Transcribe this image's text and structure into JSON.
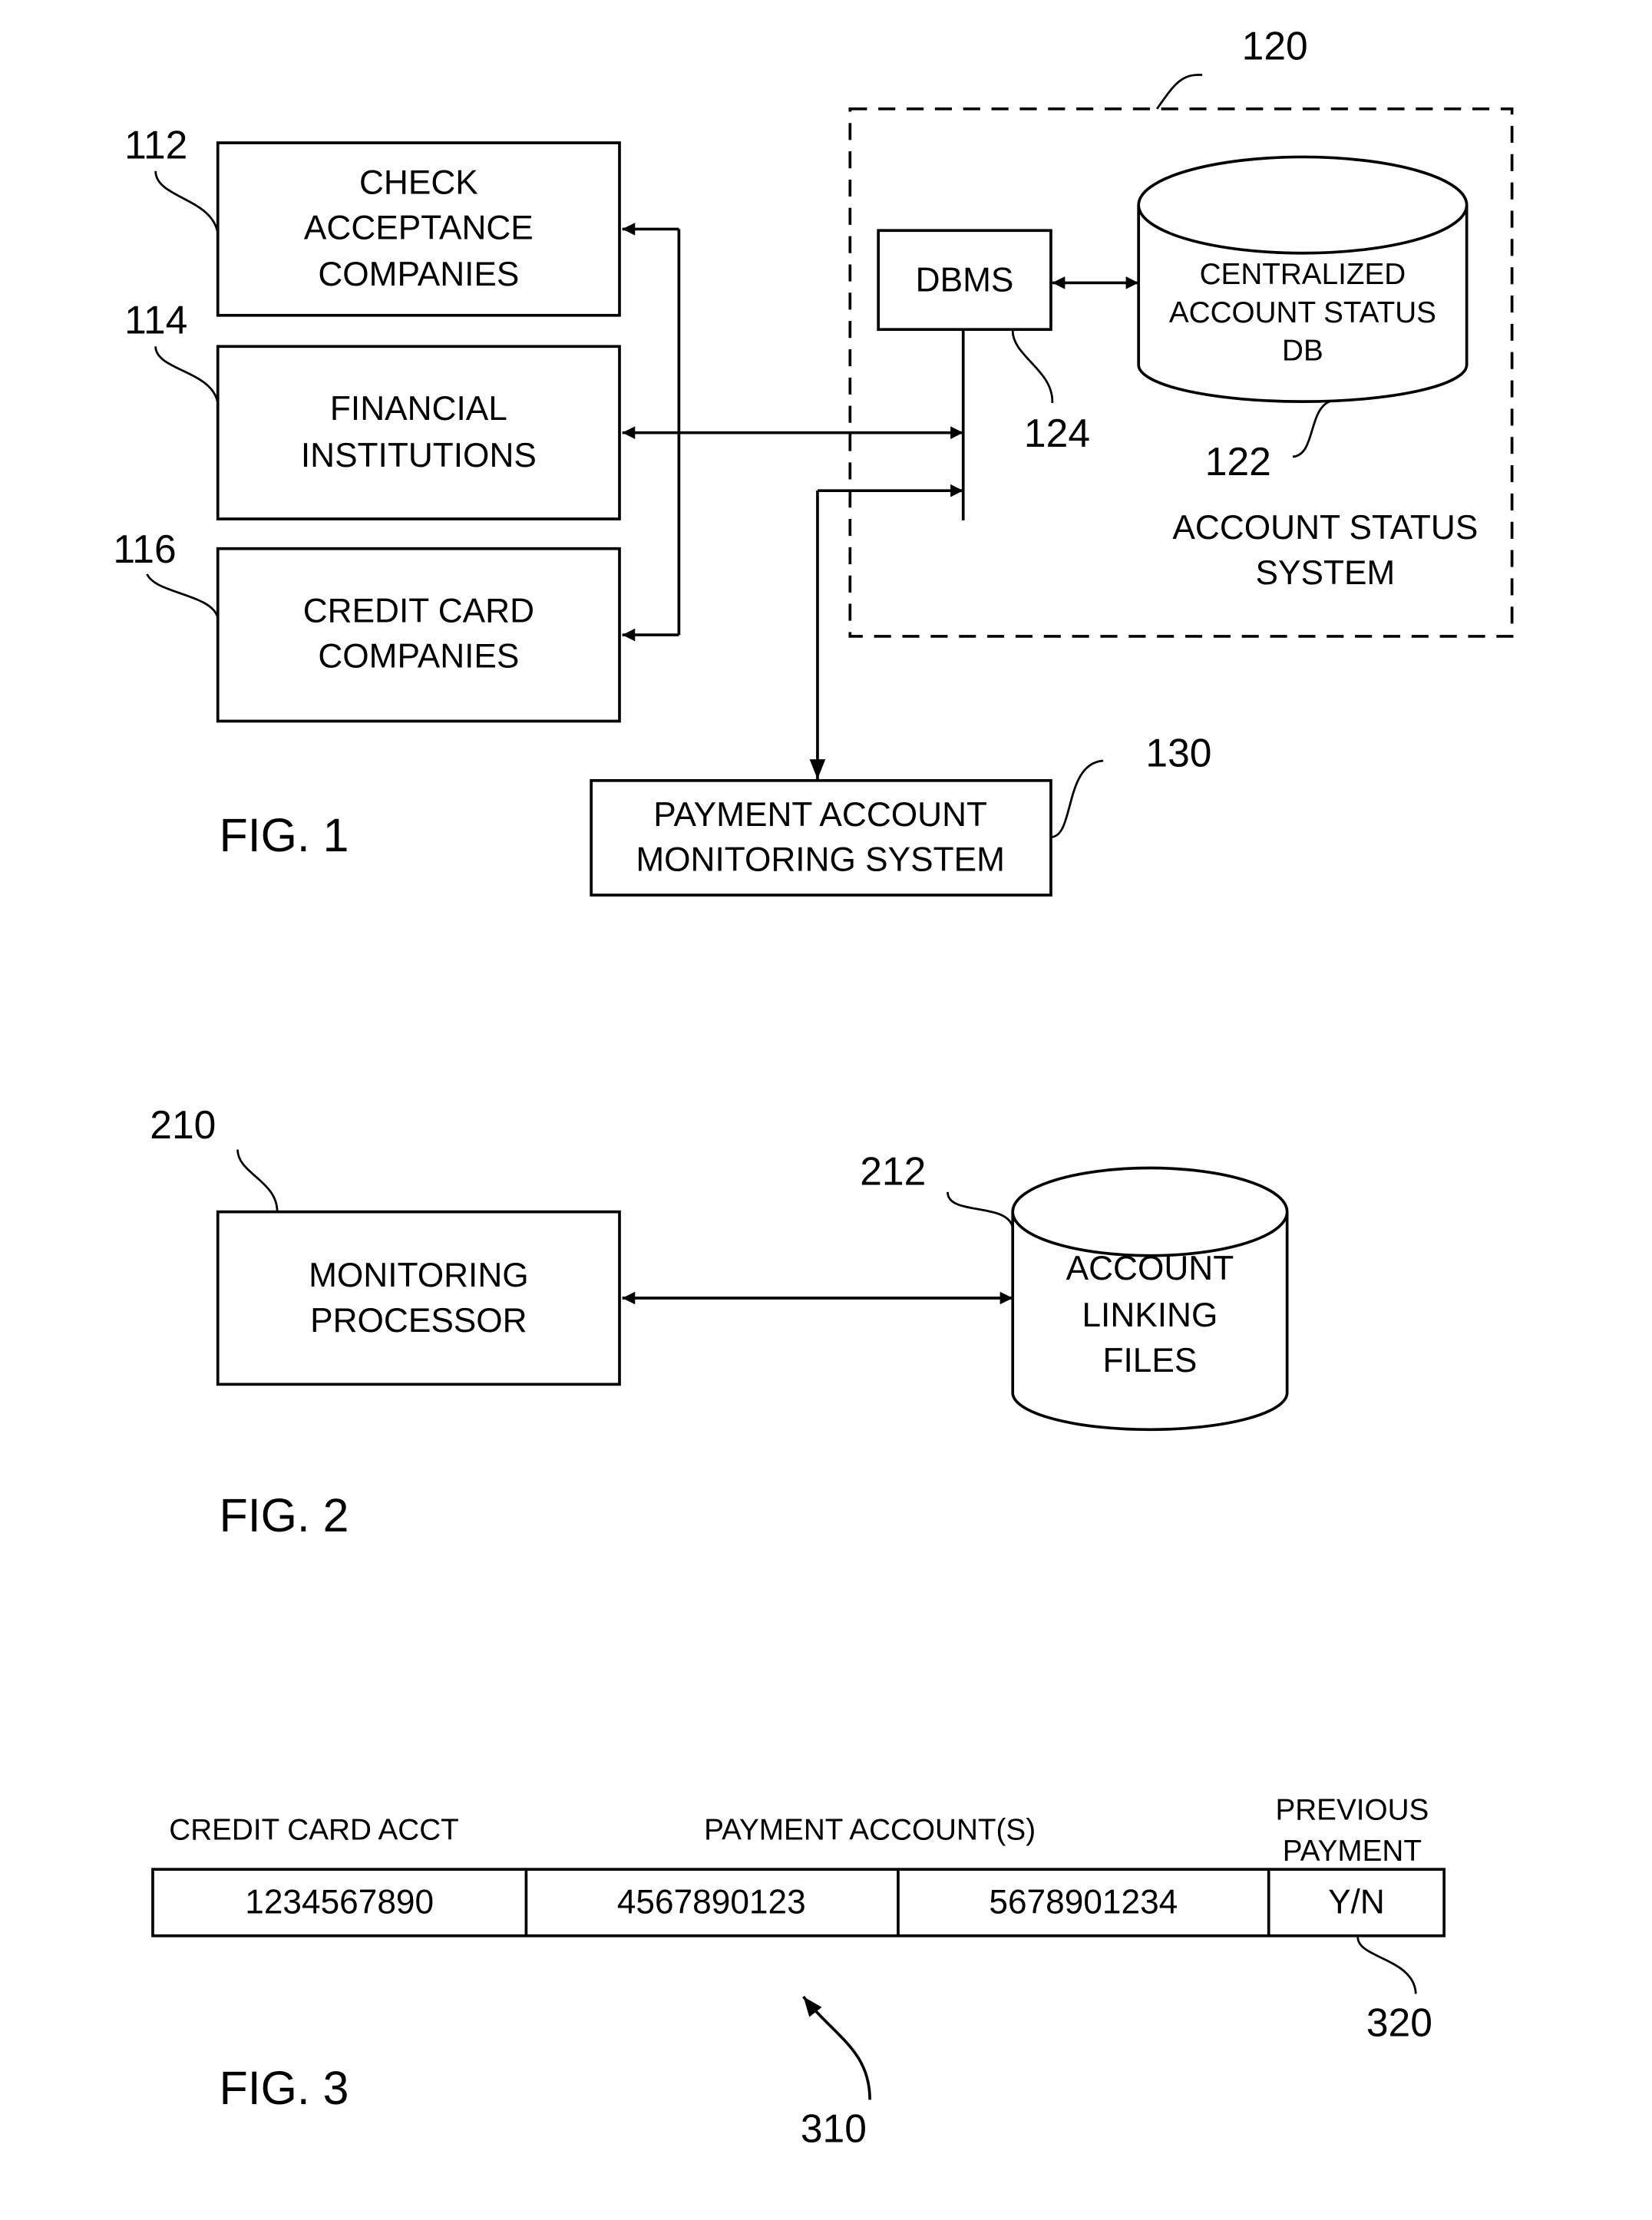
{
  "fig1": {
    "caption": "FIG. 1",
    "check_acceptance": {
      "ref": "112",
      "lines": [
        "CHECK",
        "ACCEPTANCE",
        "COMPANIES"
      ]
    },
    "financial_institutions": {
      "ref": "114",
      "lines": [
        "FINANCIAL",
        "INSTITUTIONS"
      ]
    },
    "credit_card_companies": {
      "ref": "116",
      "lines": [
        "CREDIT CARD",
        "COMPANIES"
      ]
    },
    "account_status_system": {
      "ref": "120",
      "lines": [
        "ACCOUNT STATUS",
        "SYSTEM"
      ],
      "dbms": {
        "ref": "124",
        "label": "DBMS"
      },
      "database": {
        "ref": "122",
        "lines": [
          "CENTRALIZED",
          "ACCOUNT STATUS",
          "DB"
        ]
      }
    },
    "payment_monitoring": {
      "ref": "130",
      "lines": [
        "PAYMENT ACCOUNT",
        "MONITORING SYSTEM"
      ]
    }
  },
  "fig2": {
    "caption": "FIG. 2",
    "processor": {
      "ref": "210",
      "lines": [
        "MONITORING",
        "PROCESSOR"
      ]
    },
    "linking_files": {
      "ref": "212",
      "lines": [
        "ACCOUNT",
        "LINKING",
        "FILES"
      ]
    }
  },
  "fig3": {
    "caption": "FIG. 3",
    "headers": {
      "credit_card_acct": "CREDIT CARD ACCT",
      "payment_accounts": "PAYMENT ACCOUNT(S)",
      "previous_payment": [
        "PREVIOUS",
        "PAYMENT"
      ]
    },
    "record": [
      "1234567890",
      "4567890123",
      "5678901234",
      "Y/N"
    ],
    "record_ref": "310",
    "flag_ref": "320"
  }
}
